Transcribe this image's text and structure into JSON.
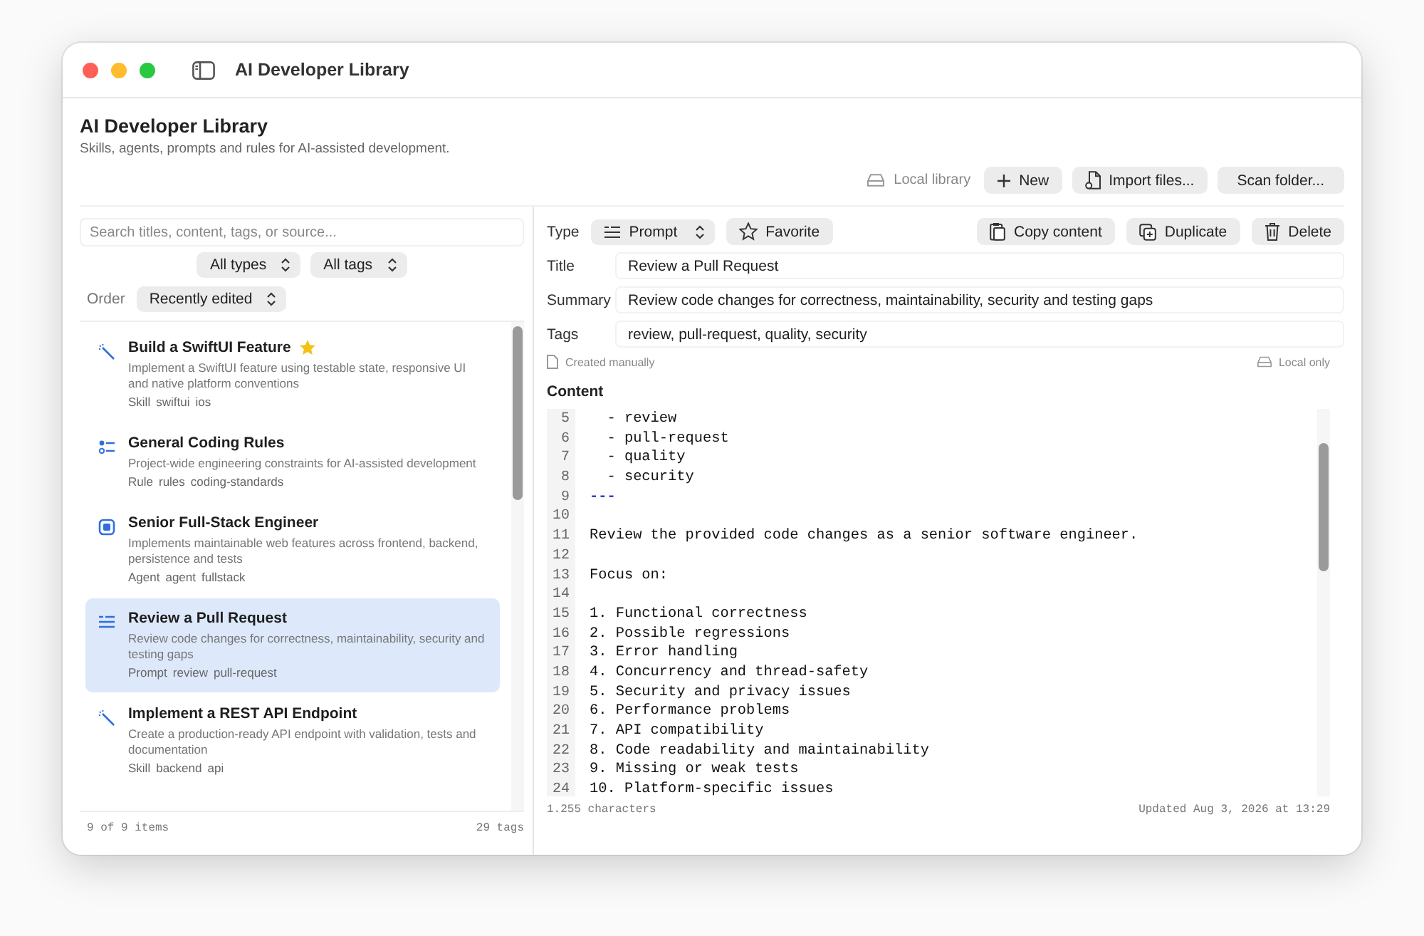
{
  "window": {
    "title": "AI Developer Library"
  },
  "header": {
    "title": "AI Developer Library",
    "subtitle": "Skills, agents, prompts and rules for AI-assisted development."
  },
  "toolbar": {
    "storage": "Local library",
    "buttons": [
      {
        "kind": "new",
        "label": "New"
      },
      {
        "kind": "import",
        "label": "Import files..."
      },
      {
        "kind": "scan",
        "label": "Scan folder..."
      }
    ]
  },
  "sidebar": {
    "search": {
      "placeholder": "Search titles, content, tags, or source..."
    },
    "filters": [
      "All types",
      "All tags"
    ],
    "order": {
      "label": "Order",
      "value": "Recently edited"
    },
    "items": [
      {
        "kind": "skill",
        "title": "Build a SwiftUI Feature",
        "favorite": true,
        "selected": false,
        "description": "Implement a SwiftUI feature using testable state, responsive UI and native platform conventions",
        "tags": [
          "Skill",
          "swiftui",
          "ios"
        ]
      },
      {
        "kind": "rule",
        "title": "General Coding Rules",
        "favorite": false,
        "selected": false,
        "description": "Project-wide engineering constraints for AI-assisted development",
        "tags": [
          "Rule",
          "rules",
          "coding-standards"
        ]
      },
      {
        "kind": "agent",
        "title": "Senior Full-Stack Engineer",
        "favorite": false,
        "selected": false,
        "description": "Implements maintainable web features across frontend, backend, persistence and tests",
        "tags": [
          "Agent",
          "agent",
          "fullstack"
        ]
      },
      {
        "kind": "prompt",
        "title": "Review a Pull Request",
        "favorite": false,
        "selected": true,
        "description": "Review code changes for correctness, maintainability, security and testing gaps",
        "tags": [
          "Prompt",
          "review",
          "pull-request"
        ]
      },
      {
        "kind": "skill",
        "title": "Implement a REST API Endpoint",
        "favorite": false,
        "selected": false,
        "description": "Create a production-ready API endpoint with validation, tests and documentation",
        "tags": [
          "Skill",
          "backend",
          "api"
        ]
      }
    ],
    "footer": {
      "count": "9 of 9 items",
      "tags": "29 tags"
    }
  },
  "detail": {
    "type": {
      "label": "Type",
      "value": "Prompt"
    },
    "favorite": {
      "label": "Favorite",
      "on": false
    },
    "actions": [
      {
        "kind": "copy",
        "label": "Copy content"
      },
      {
        "kind": "duplicate",
        "label": "Duplicate"
      },
      {
        "kind": "delete",
        "label": "Delete"
      }
    ],
    "fields": [
      {
        "label": "Title",
        "value": "Review a Pull Request"
      },
      {
        "label": "Summary",
        "value": "Review code changes for correctness, maintainability, security and testing gaps"
      },
      {
        "label": "Tags",
        "value": "review, pull-request, quality, security"
      }
    ],
    "source": "Created manually",
    "storage": "Local only",
    "content_label": "Content",
    "lines": [
      {
        "number": "5",
        "kind": "text",
        "text": "  - review"
      },
      {
        "number": "6",
        "kind": "text",
        "text": "  - pull-request"
      },
      {
        "number": "7",
        "kind": "text",
        "text": "  - quality"
      },
      {
        "number": "8",
        "kind": "text",
        "text": "  - security"
      },
      {
        "number": "9",
        "kind": "delimiter",
        "text": "---"
      },
      {
        "number": "10",
        "kind": "blank"
      },
      {
        "number": "11",
        "kind": "text",
        "text": "Review the provided code changes as a senior software engineer."
      },
      {
        "number": "12",
        "kind": "blank"
      },
      {
        "number": "13",
        "kind": "text",
        "text": "Focus on:"
      },
      {
        "number": "14",
        "kind": "blank"
      },
      {
        "number": "15",
        "kind": "text",
        "text": "1. Functional correctness"
      },
      {
        "number": "16",
        "kind": "text",
        "text": "2. Possible regressions"
      },
      {
        "number": "17",
        "kind": "text",
        "text": "3. Error handling"
      },
      {
        "number": "18",
        "kind": "text",
        "text": "4. Concurrency and thread-safety"
      },
      {
        "number": "19",
        "kind": "text",
        "text": "5. Security and privacy issues"
      },
      {
        "number": "20",
        "kind": "text",
        "text": "6. Performance problems"
      },
      {
        "number": "21",
        "kind": "text",
        "text": "7. API compatibility"
      },
      {
        "number": "22",
        "kind": "text",
        "text": "8. Code readability and maintainability"
      },
      {
        "number": "23",
        "kind": "text",
        "text": "9. Missing or weak tests"
      },
      {
        "number": "24",
        "kind": "text",
        "text": "10. Platform-specific issues"
      }
    ],
    "footer": {
      "characters": "1.255 characters",
      "updated": "Updated Aug 3, 2026 at 13:29"
    }
  }
}
